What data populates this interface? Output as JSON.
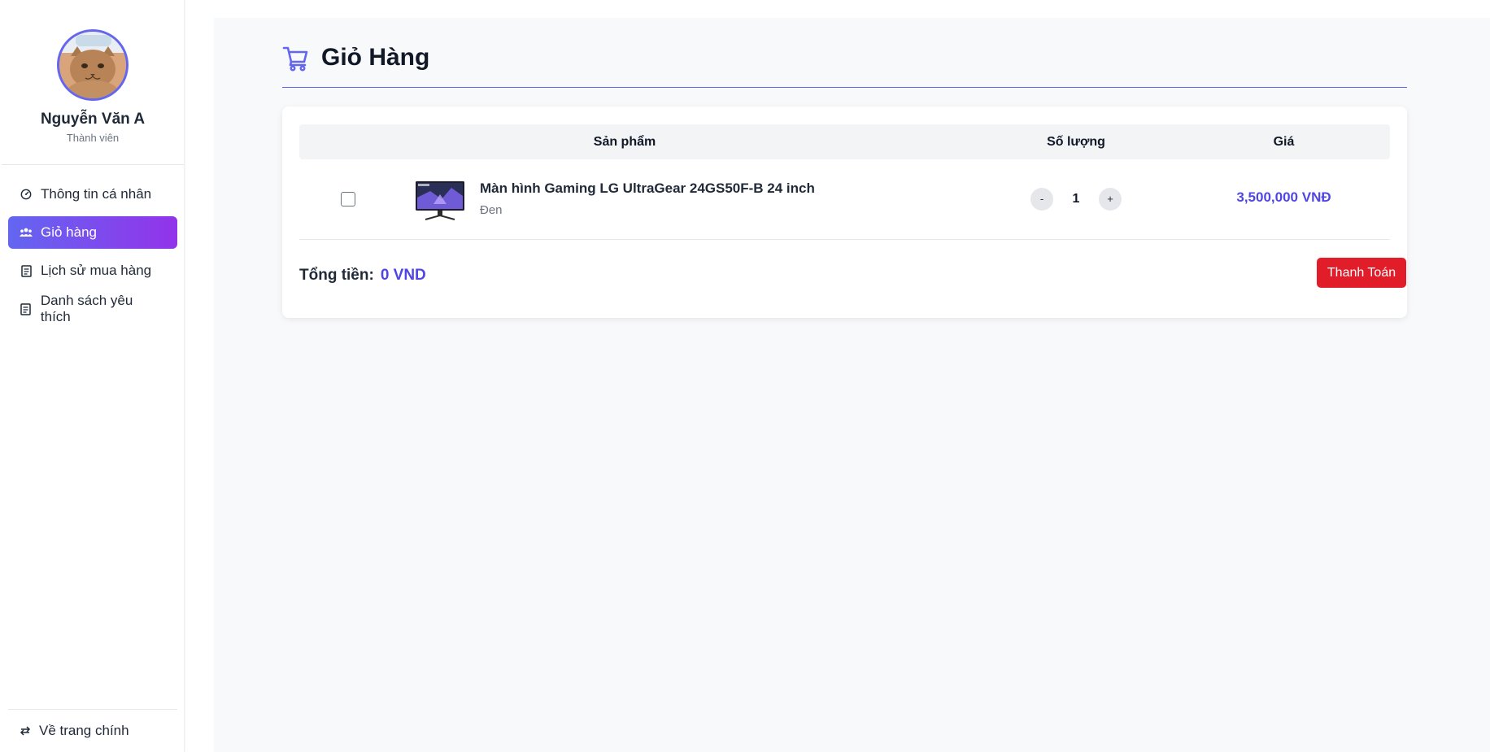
{
  "user": {
    "name": "Nguyễn Văn A",
    "role": "Thành viên"
  },
  "sidebar": {
    "items": [
      {
        "label": "Thông tin cá nhân",
        "icon": "dashboard-gauge-icon",
        "active": false
      },
      {
        "label": "Giỏ hàng",
        "icon": "users-icon",
        "active": true
      },
      {
        "label": "Lịch sử mua hàng",
        "icon": "document-icon",
        "active": false
      },
      {
        "label": "Danh sách yêu thích",
        "icon": "document-icon",
        "active": false
      }
    ],
    "back_label": "Về trang chính",
    "back_icon": "exchange-arrows-icon"
  },
  "page": {
    "title": "Giỏ Hàng",
    "title_icon": "shopping-cart-icon"
  },
  "cart": {
    "columns": {
      "product": "Sản phẩm",
      "quantity": "Số lượng",
      "price": "Giá"
    },
    "items": [
      {
        "selected": false,
        "name": "Màn hình Gaming LG UltraGear 24GS50F-B 24 inch",
        "variant": "Đen",
        "quantity": "1",
        "price": "3,500,000 VNĐ",
        "minus_label": "-",
        "plus_label": "+"
      }
    ],
    "total_label": "Tổng tiền:",
    "total_value": "0 VND",
    "checkout_label": "Thanh Toán"
  },
  "colors": {
    "accent": "#6366f1",
    "accent_gradient_end": "#9333ea",
    "price": "#4f46e5",
    "checkout": "#e11d2a"
  }
}
